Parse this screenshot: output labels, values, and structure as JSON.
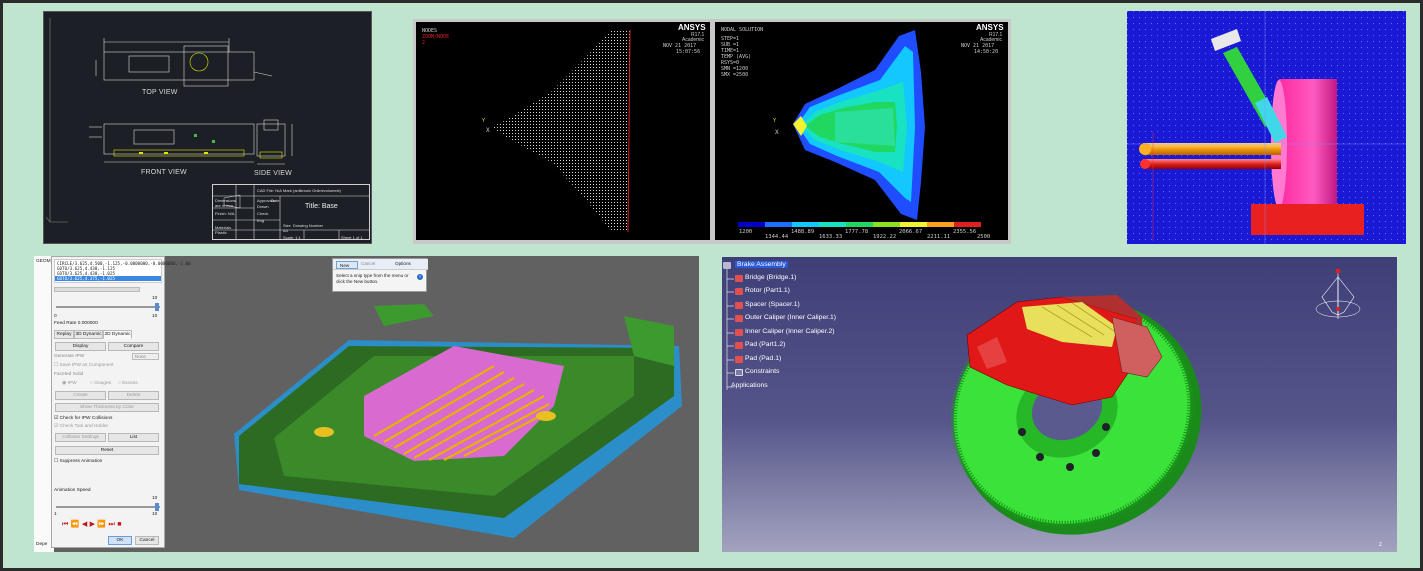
{
  "colors": {
    "page_bg": "#bfe5cf",
    "cad_bg": "#1c2026",
    "ansys_bg": "#000000",
    "mech_bg": "#1a1ad6",
    "cam_bg": "#616161",
    "catia_top": "#3f3f78",
    "catia_bottom": "#a3a3bf",
    "part_green": "#2ad62a",
    "caliper_red": "#e01818"
  },
  "cad": {
    "top_view": "TOP VIEW",
    "front_view": "FRONT VIEW",
    "side_view": "SIDE VIEW",
    "title_block": {
      "title": "Title: Base",
      "author": "Mark (anilkmolx Onlinevolumele)",
      "approvals": "Approvals",
      "date": "Date",
      "drawn": "Drawn",
      "check": "Check",
      "eng": "Eng",
      "size": "Size",
      "size_value": "A4",
      "drawing_number": "Drawing Number",
      "scale": "Scale: 1:1",
      "sheet": "Sheet 1 of 1",
      "cad_file": "CAD File: N/A",
      "dimensions": "Dimensions are in mm",
      "finish": "Finish: N/A",
      "material": "Materials Plastic"
    }
  },
  "ansys": {
    "left": {
      "line1": "NODES",
      "line2": "ZOOM/NODE",
      "line3": "2",
      "logo": "ANSYS",
      "version": "R17.1",
      "academic": "Academic",
      "date": "NOV 21 2017",
      "time": "15:07:56"
    },
    "right": {
      "lines": [
        "NODAL SOLUTION",
        "STEP=1",
        "SUB =1",
        "TIME=1",
        "TEMP    (AVG)",
        "RSYS=0",
        "SMN =1200",
        "SMX =2500"
      ],
      "logo": "ANSYS",
      "version": "R17.1",
      "academic": "Academic",
      "date": "NOV 21 2017",
      "time": "14:50:20",
      "colorbar_top": [
        "1200",
        "1488.89",
        "1777.78",
        "2066.67",
        "2355.56"
      ],
      "colorbar_bottom": [
        "1344.44",
        "1633.33",
        "1922.22",
        "2211.11",
        "2500"
      ]
    }
  },
  "cam": {
    "gcode": [
      "CIRCLE/3.625,4.500,-1.125,-0.0000000,-0.0000000,-1.00",
      "GOTO/3.625,4.438,-1.125",
      "GOTO/3.625,4.438,-1.025",
      "GOTO/3.625,4.375,-1.025"
    ],
    "slider_max": "10",
    "slider_min": "0",
    "feed_rate": "Feed Rate 0.000000",
    "tabs": [
      "Replay",
      "3D Dynamic",
      "2D Dynamic"
    ],
    "display": "Display",
    "compare": "Compare",
    "generate_ipw": "Generate IPW",
    "generate_value": "None",
    "save_ipw": "Save IPW as Component",
    "faceted_solid": "Faceted Solid",
    "radio_ipw": "IPW",
    "radio_gouges": "Gouges",
    "radio_excess": "Excess",
    "create": "Create",
    "delete": "Delete",
    "show_thickness": "Show Thickness by Color",
    "check_collisions": "Check for IPW Collisions",
    "check_tool": "Check Tool and Holder",
    "collision_settings": "Collision Settings",
    "list": "List",
    "reset": "Reset",
    "suppress": "Suppress Animation",
    "animation_speed": "Animation Speed",
    "speed_max": "10",
    "speed_min": "1",
    "ok": "OK",
    "cancel": "Cancel",
    "left_top": "GEOM",
    "left_bottom": "Depe",
    "snip": {
      "new": "New",
      "cancel": "Cancel",
      "options": "Options",
      "message": "Select a snip type from the menu or click the New button."
    }
  },
  "catia": {
    "tree": [
      "Brake Assembly",
      "Bridge (Bridge.1)",
      "Rotor (Part1.1)",
      "Spacer (Spacer.1)",
      "Outer Caliper (Inner Caliper.1)",
      "Inner Caliper (Inner Caliper.2)",
      "Pad (Part1.2)",
      "Pad (Pad.1)",
      "Constraints",
      "Applications"
    ],
    "axis_label": "z"
  }
}
